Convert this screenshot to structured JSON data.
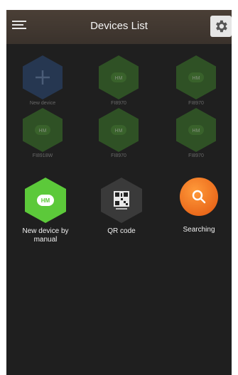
{
  "header": {
    "title": "Devices List",
    "menu_icon": "hamburger-menu-icon",
    "settings_icon": "gear-icon"
  },
  "devices": [
    {
      "label": "New device",
      "icon": "plus-icon",
      "color": "#2c4b7a"
    },
    {
      "label": "FI8970",
      "icon": "hm-camera-icon",
      "color": "#3d7a2a"
    },
    {
      "label": "FI8970",
      "icon": "hm-camera-icon",
      "color": "#3d7a2a"
    },
    {
      "label": "FI8918W",
      "icon": "hm-camera-icon",
      "color": "#3d7a2a"
    },
    {
      "label": "FI8970",
      "icon": "hm-camera-icon",
      "color": "#3d7a2a"
    },
    {
      "label": "FI8970",
      "icon": "hm-camera-icon",
      "color": "#3d7a2a"
    }
  ],
  "actions": [
    {
      "label": "New device by manual",
      "icon": "hm-add-icon",
      "color": "#5cc93a"
    },
    {
      "label": "QR code",
      "icon": "qr-code-icon",
      "color": "#3a3a3a"
    },
    {
      "label": "Searching",
      "icon": "magnifier-icon",
      "color": "#f07a1c"
    }
  ]
}
